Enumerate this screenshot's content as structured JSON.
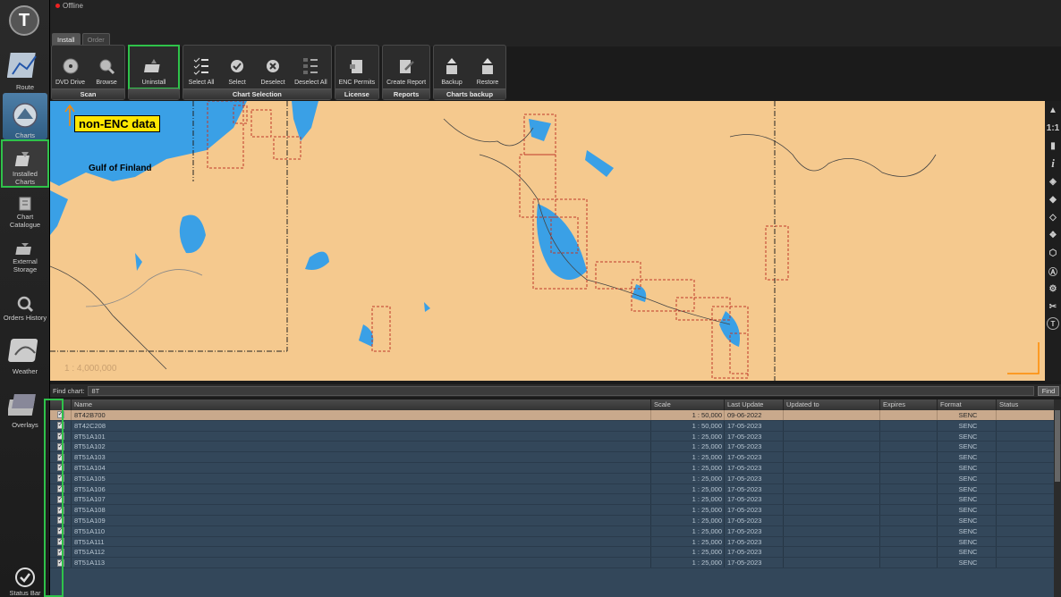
{
  "status": {
    "connection": "Offline"
  },
  "tabs": [
    {
      "label": "Install"
    },
    {
      "label": "Order"
    }
  ],
  "sidebar": {
    "items": [
      {
        "label": "Route"
      },
      {
        "label": "Charts"
      },
      {
        "label": "Installed Charts"
      },
      {
        "label": "Chart Catalogue"
      },
      {
        "label": "External Storage"
      },
      {
        "label": "Orders History"
      },
      {
        "label": "Weather"
      },
      {
        "label": "Overlays"
      },
      {
        "label": "Status Bar"
      }
    ]
  },
  "ribbon": {
    "groups": [
      {
        "title": "Scan",
        "buttons": [
          "DVD Drive",
          "Browse"
        ]
      },
      {
        "title": "",
        "buttons": [
          "Uninstall"
        ]
      },
      {
        "title": "Chart Selection",
        "buttons": [
          "Select All",
          "Select",
          "Deselect",
          "Deselect All"
        ]
      },
      {
        "title": "License",
        "buttons": [
          "ENC Permits"
        ]
      },
      {
        "title": "Reports",
        "buttons": [
          "Create Report"
        ]
      },
      {
        "title": "Charts backup",
        "buttons": [
          "Backup",
          "Restore"
        ]
      }
    ]
  },
  "map": {
    "badge": "non-ENC data",
    "place_label": "Gulf of Finland",
    "scale_text": "1 : 4,000,000",
    "colors": {
      "land": "#f5c98e",
      "water": "#3aa0e6",
      "chart_outline": "#c0392b"
    }
  },
  "right_toolbar": {
    "zoom_label": "1:1",
    "info_label": "i"
  },
  "find": {
    "label": "Find chart:",
    "value": "8T",
    "button": "Find"
  },
  "table": {
    "columns": [
      "",
      "Name",
      "Scale",
      "Last Update",
      "Updated to",
      "Expires",
      "Format",
      "Status"
    ],
    "rows": [
      {
        "name": "8T42B700",
        "scale": "1 : 50,000",
        "last_update": "09-06-2022",
        "format": "SENC"
      },
      {
        "name": "8T42C208",
        "scale": "1 : 50,000",
        "last_update": "17-05-2023",
        "format": "SENC"
      },
      {
        "name": "8T51A101",
        "scale": "1 : 25,000",
        "last_update": "17-05-2023",
        "format": "SENC"
      },
      {
        "name": "8T51A102",
        "scale": "1 : 25,000",
        "last_update": "17-05-2023",
        "format": "SENC"
      },
      {
        "name": "8T51A103",
        "scale": "1 : 25,000",
        "last_update": "17-05-2023",
        "format": "SENC"
      },
      {
        "name": "8T51A104",
        "scale": "1 : 25,000",
        "last_update": "17-05-2023",
        "format": "SENC"
      },
      {
        "name": "8T51A105",
        "scale": "1 : 25,000",
        "last_update": "17-05-2023",
        "format": "SENC"
      },
      {
        "name": "8T51A106",
        "scale": "1 : 25,000",
        "last_update": "17-05-2023",
        "format": "SENC"
      },
      {
        "name": "8T51A107",
        "scale": "1 : 25,000",
        "last_update": "17-05-2023",
        "format": "SENC"
      },
      {
        "name": "8T51A108",
        "scale": "1 : 25,000",
        "last_update": "17-05-2023",
        "format": "SENC"
      },
      {
        "name": "8T51A109",
        "scale": "1 : 25,000",
        "last_update": "17-05-2023",
        "format": "SENC"
      },
      {
        "name": "8T51A110",
        "scale": "1 : 25,000",
        "last_update": "17-05-2023",
        "format": "SENC"
      },
      {
        "name": "8T51A111",
        "scale": "1 : 25,000",
        "last_update": "17-05-2023",
        "format": "SENC"
      },
      {
        "name": "8T51A112",
        "scale": "1 : 25,000",
        "last_update": "17-05-2023",
        "format": "SENC"
      },
      {
        "name": "8T51A113",
        "scale": "1 : 25,000",
        "last_update": "17-05-2023",
        "format": "SENC"
      }
    ]
  }
}
